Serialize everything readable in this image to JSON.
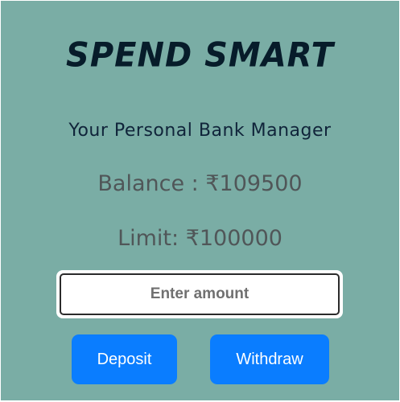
{
  "app": {
    "title": "SPEND SMART",
    "subtitle": "Your Personal Bank Manager"
  },
  "balance": {
    "label": "Balance : ",
    "value": "₹109500"
  },
  "limit": {
    "label": "Limit: ",
    "value": "₹100000"
  },
  "amount_input": {
    "placeholder": "Enter amount",
    "value": ""
  },
  "actions": {
    "deposit_label": "Deposit",
    "withdraw_label": "Withdraw"
  },
  "colors": {
    "background": "#7aada5",
    "title": "#071c2a",
    "button": "#0a7dff",
    "button_text": "#ffffff",
    "stat_text": "#505658"
  }
}
